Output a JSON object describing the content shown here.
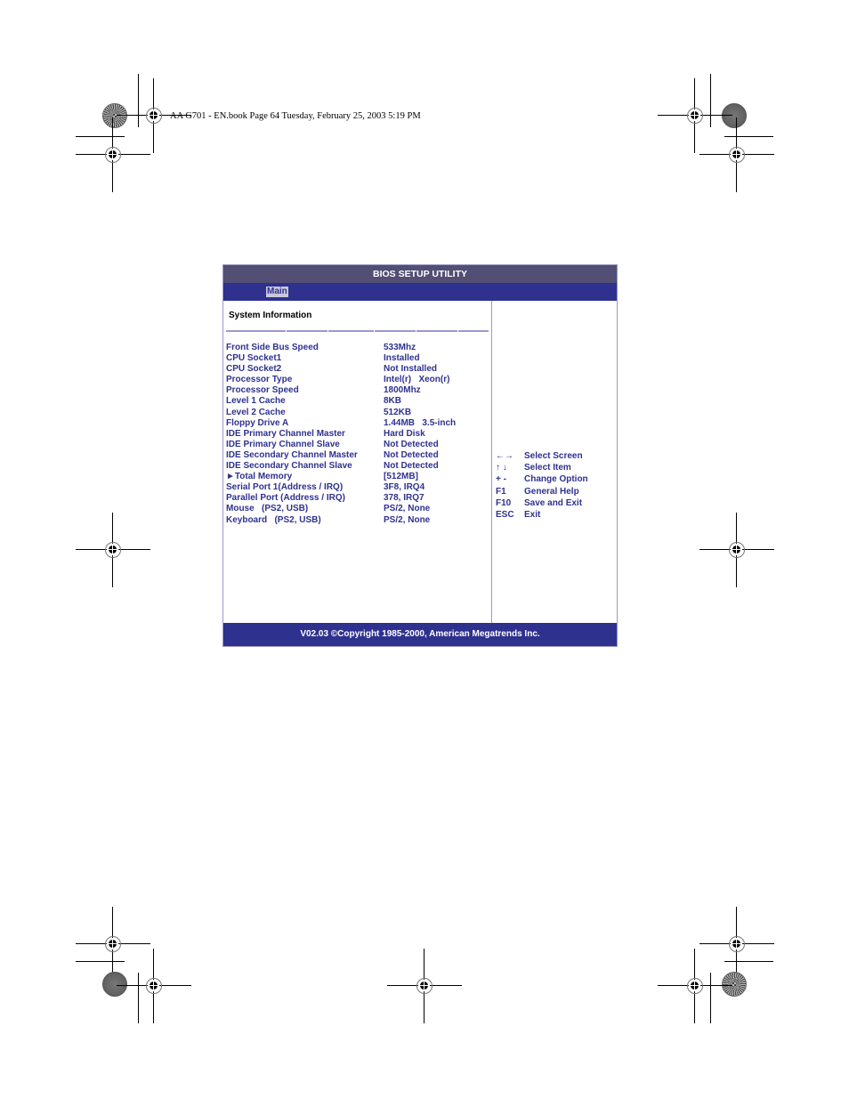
{
  "page_header": {
    "text": "AA G701 - EN.book  Page 64  Tuesday, February 25, 2003  5:19 PM"
  },
  "bios": {
    "title": "BIOS SETUP UTILITY",
    "tabs": [
      {
        "label": "Main",
        "selected": true
      }
    ],
    "section_title": "System Information",
    "rows": [
      {
        "label": "Front Side Bus Speed",
        "value": "533Mhz"
      },
      {
        "label": "CPU Socket1",
        "value": "Installed"
      },
      {
        "label": "CPU Socket2",
        "value": "Not Installed"
      },
      {
        "label": "Processor Type",
        "value": "Intel(r)   Xeon(r)"
      },
      {
        "label": "Processor Speed",
        "value": "1800Mhz"
      },
      {
        "label": "Level 1 Cache",
        "value": "8KB"
      },
      {
        "label": "Level 2 Cache",
        "value": "512KB"
      },
      {
        "label": "Floppy Drive A",
        "value": "1.44MB   3.5-inch"
      },
      {
        "label": "IDE Primary Channel Master",
        "value": "Hard Disk"
      },
      {
        "label": "IDE Primary Channel Slave",
        "value": "Not Detected"
      },
      {
        "label": "IDE Secondary Channel Master",
        "value": "Not Detected"
      },
      {
        "label": "IDE Secondary Channel Slave",
        "value": "Not Detected"
      },
      {
        "label": "►Total Memory",
        "value": "[512MB]"
      },
      {
        "label": "Serial Port 1(Address / IRQ)",
        "value": "3F8, IRQ4"
      },
      {
        "label": "Parallel Port (Address / IRQ)",
        "value": "378, IRQ7"
      },
      {
        "label": "Mouse   (PS2, USB)",
        "value": "PS/2, None"
      },
      {
        "label": "Keyboard   (PS2, USB)",
        "value": "PS/2, None"
      }
    ],
    "help": [
      {
        "key": "←→",
        "desc": "Select Screen"
      },
      {
        "key": "↑ ↓",
        "desc": "Select Item"
      },
      {
        "key": "+ -",
        "desc": "Change Option"
      },
      {
        "key": "F1",
        "desc": "General Help"
      },
      {
        "key": "F10",
        "desc": "Save and Exit"
      },
      {
        "key": "ESC",
        "desc": "Exit"
      }
    ],
    "footer": "V02.03 ©Copyright 1985-2000, American Megatrends Inc.",
    "colors": {
      "title_bar": "#524e74",
      "menu_bar": "#2f318f",
      "text": "#2f318f",
      "border": "#9a9ac8"
    }
  }
}
